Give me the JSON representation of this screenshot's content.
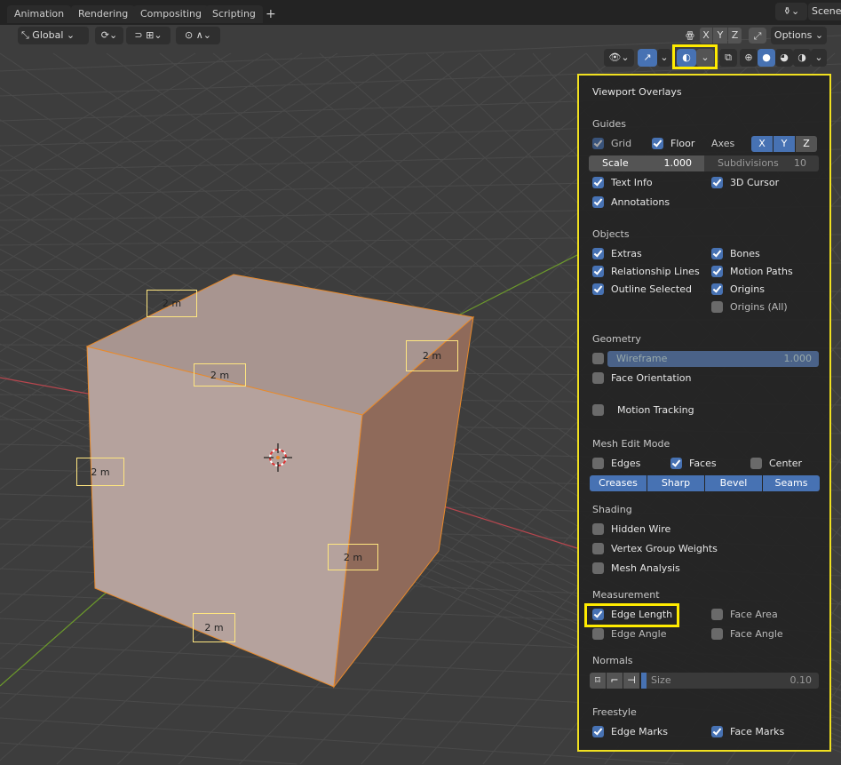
{
  "workspace_tabs": [
    "Animation",
    "Rendering",
    "Compositing",
    "Scripting"
  ],
  "add_tab": "+",
  "scene": {
    "label": "Scene"
  },
  "toolbar": {
    "orientation": "Global",
    "axes": [
      "X",
      "Y",
      "Z"
    ],
    "options": "Options"
  },
  "viewport": {
    "edge_labels": [
      "2 m",
      "2 m",
      "2 m",
      "2 m",
      "2 m",
      "2 m"
    ],
    "colors": {
      "x_axis": "#b8464e",
      "y_axis": "#6c9a2b",
      "mesh_face": "#b5a29d",
      "mesh_edge": "#e88a2b"
    }
  },
  "overlays": {
    "title": "Viewport Overlays",
    "guides": {
      "header": "Guides",
      "grid": "Grid",
      "floor": "Floor",
      "axes_label": "Axes",
      "axes": [
        "X",
        "Y",
        "Z"
      ],
      "scale_label": "Scale",
      "scale_value": "1.000",
      "subdivisions_label": "Subdivisions",
      "subdivisions_value": "10",
      "text_info": "Text Info",
      "cursor_3d": "3D Cursor",
      "annotations": "Annotations"
    },
    "objects": {
      "header": "Objects",
      "extras": "Extras",
      "bones": "Bones",
      "relationship_lines": "Relationship Lines",
      "motion_paths": "Motion Paths",
      "outline_selected": "Outline Selected",
      "origins": "Origins",
      "origins_all": "Origins (All)"
    },
    "geometry": {
      "header": "Geometry",
      "wireframe_label": "Wireframe",
      "wireframe_value": "1.000",
      "face_orientation": "Face Orientation",
      "motion_tracking": "Motion Tracking"
    },
    "mesh_edit": {
      "header": "Mesh Edit Mode",
      "edges": "Edges",
      "faces": "Faces",
      "center": "Center",
      "buttons": [
        "Creases",
        "Sharp",
        "Bevel",
        "Seams"
      ]
    },
    "shading": {
      "header": "Shading",
      "hidden_wire": "Hidden Wire",
      "vertex_group_weights": "Vertex Group Weights",
      "mesh_analysis": "Mesh Analysis"
    },
    "measurement": {
      "header": "Measurement",
      "edge_length": "Edge Length",
      "face_area": "Face Area",
      "edge_angle": "Edge Angle",
      "face_angle": "Face Angle"
    },
    "normals": {
      "header": "Normals",
      "size_label": "Size",
      "size_value": "0.10"
    },
    "freestyle": {
      "header": "Freestyle",
      "edge_marks": "Edge Marks",
      "face_marks": "Face Marks"
    },
    "checked": {
      "grid": true,
      "floor": true,
      "text_info": true,
      "cursor_3d": true,
      "annotations": true,
      "extras": true,
      "bones": true,
      "relationship_lines": true,
      "motion_paths": true,
      "outline_selected": true,
      "origins": true,
      "origins_all": false,
      "wireframe": false,
      "face_orientation": false,
      "motion_tracking": false,
      "edges": false,
      "faces": true,
      "center": false,
      "hidden_wire": false,
      "vertex_group_weights": false,
      "mesh_analysis": false,
      "edge_length": true,
      "face_area": false,
      "edge_angle": false,
      "face_angle": false,
      "edge_marks": true,
      "face_marks": true
    }
  }
}
